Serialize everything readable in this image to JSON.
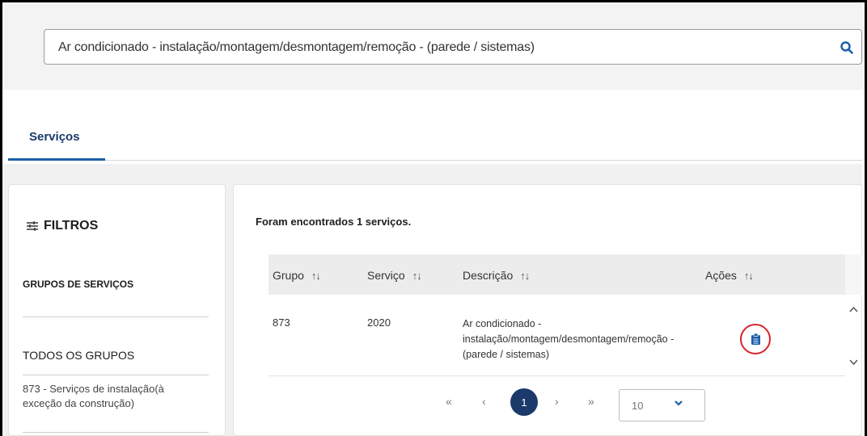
{
  "search": {
    "value": "Ar condicionado - instalação/montagem/desmontagem/remoção - (parede / sistemas)"
  },
  "tabs": [
    {
      "label": "Serviços",
      "active": true
    }
  ],
  "sidebar": {
    "title": "FILTROS",
    "groups_label": "GRUPOS DE SERVIÇOS",
    "all_groups_label": "TODOS OS GRUPOS",
    "group_items": [
      {
        "label": "873 - Serviços de instalação(à exceção da construção)"
      }
    ]
  },
  "results": {
    "found_text": "Foram encontrados 1 serviços.",
    "columns": [
      "Grupo",
      "Serviço",
      "Descrição",
      "Ações"
    ],
    "sort_icon": "↑↓",
    "rows": [
      {
        "grupo": "873",
        "servico": "2020",
        "descricao": "Ar condicionado - instalação/montagem/desmontagem/remoção - (parede / sistemas)",
        "action_icon": "clipboard-icon"
      }
    ]
  },
  "pagination": {
    "first": "«",
    "prev": "‹",
    "current_page": "1",
    "next": "›",
    "last": "»",
    "page_size": "10"
  },
  "colors": {
    "accent": "#1b3a6b",
    "tab_underline": "#1a5fa8",
    "highlight_circle": "#d9232d",
    "search_icon": "#1a5fa8"
  }
}
